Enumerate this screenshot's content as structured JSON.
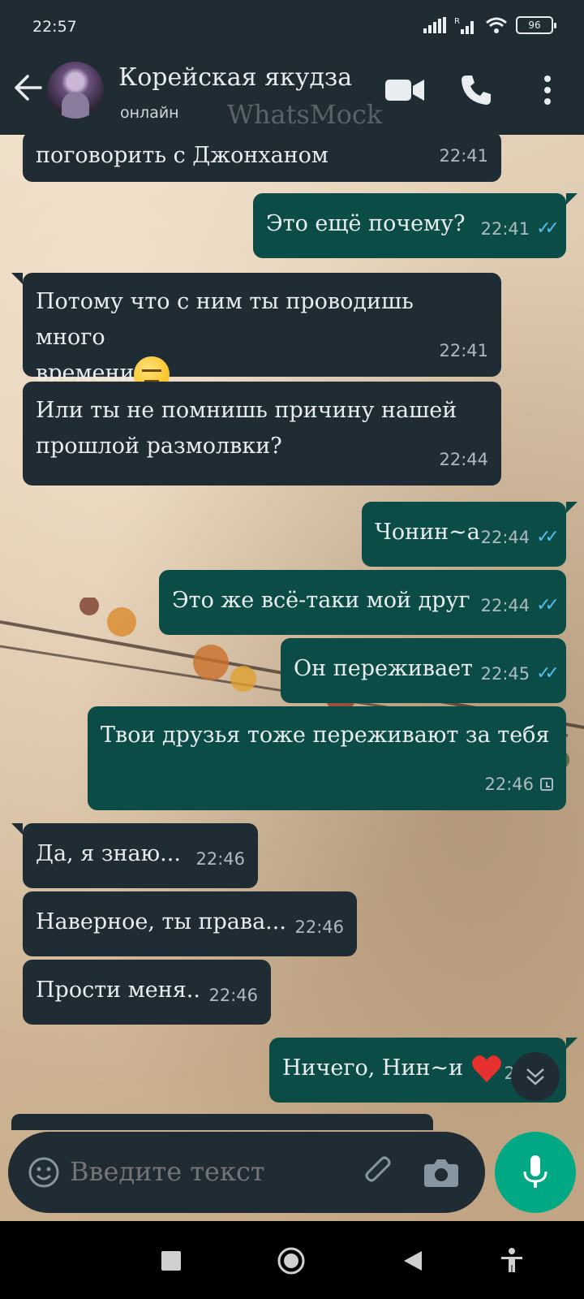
{
  "status_bar": {
    "time": "22:57",
    "battery": "96"
  },
  "header": {
    "contact_name": "Корейская якудза",
    "contact_status": "онлайн",
    "watermark": "WhatsMock"
  },
  "messages": [
    {
      "dir": "in",
      "text": "поговорить с Джонханом",
      "time": "22:41"
    },
    {
      "dir": "out",
      "text": "Это ещё почему?",
      "time": "22:41",
      "status": "read"
    },
    {
      "dir": "in",
      "text": "Потому что с ним ты проводишь много\nвремени",
      "emoji": "expressionless-face",
      "time": "22:41"
    },
    {
      "dir": "in",
      "text": "Или ты не помнишь причину нашей\nпрошлой размолвки?",
      "time": "22:44"
    },
    {
      "dir": "out",
      "text": "Чонин~а",
      "time": "22:44",
      "status": "read"
    },
    {
      "dir": "out",
      "text": "Это же всё-таки мой друг",
      "time": "22:44",
      "status": "read"
    },
    {
      "dir": "out",
      "text": "Он переживает",
      "time": "22:45",
      "status": "read"
    },
    {
      "dir": "out",
      "text": "Твои друзья тоже переживают за тебя",
      "time": "22:46",
      "status": "pending"
    },
    {
      "dir": "in",
      "text": "Да, я знаю...",
      "time": "22:46"
    },
    {
      "dir": "in",
      "text": "Наверное, ты права...",
      "time": "22:46"
    },
    {
      "dir": "in",
      "text": "Прости меня..",
      "time": "22:46"
    },
    {
      "dir": "out",
      "text": "Ничего, Нин~и",
      "emoji": "red-heart",
      "time": "22:46",
      "status": "read"
    }
  ],
  "composer": {
    "placeholder": "Введите текст"
  },
  "colors": {
    "header": "#1f2c34",
    "incoming": "#1f2c34",
    "outgoing": "#0b4d46",
    "accent": "#00a884",
    "read_tick": "#53bdeb"
  }
}
